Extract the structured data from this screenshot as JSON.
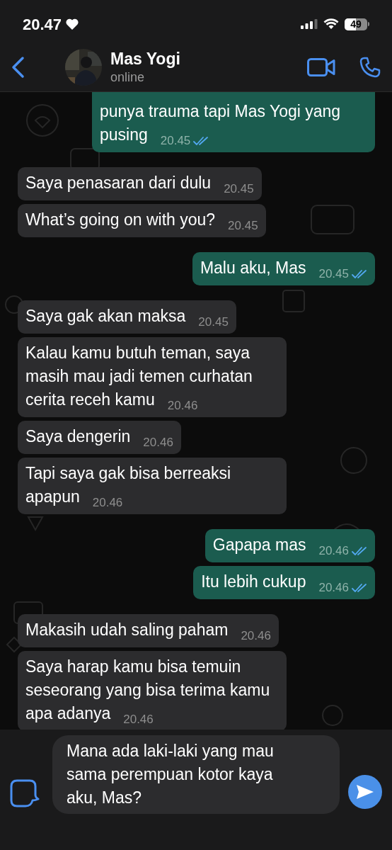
{
  "status_bar": {
    "time": "20.47",
    "battery": "49"
  },
  "header": {
    "name": "Mas Yogi",
    "status": "online"
  },
  "messages": [
    {
      "kind": "sent",
      "text": "punya trauma tapi Mas Yogi yang pusing",
      "time": "20.45",
      "read": true,
      "cut_top": true
    },
    {
      "kind": "received",
      "text": "Saya penasaran dari dulu",
      "time": "20.45"
    },
    {
      "kind": "received",
      "text": "What’s going on with you?",
      "time": "20.45"
    },
    {
      "kind": "sent",
      "text": "Malu aku, Mas",
      "time": "20.45",
      "read": true
    },
    {
      "kind": "received",
      "text": "Saya gak akan maksa",
      "time": "20.45"
    },
    {
      "kind": "received",
      "text": "Kalau kamu butuh teman, saya masih mau jadi temen curhatan cerita receh kamu",
      "time": "20.46"
    },
    {
      "kind": "received",
      "text": "Saya dengerin",
      "time": "20.46"
    },
    {
      "kind": "received",
      "text": "Tapi saya gak bisa berreaksi apapun",
      "time": "20.46"
    },
    {
      "kind": "sent",
      "text": "Gapapa mas",
      "time": "20.46",
      "read": true
    },
    {
      "kind": "sent",
      "text": "Itu lebih cukup",
      "time": "20.46",
      "read": true
    },
    {
      "kind": "received",
      "text": "Makasih udah saling paham",
      "time": "20.46"
    },
    {
      "kind": "received",
      "text": "Saya harap kamu bisa temuin seseorang yang bisa terima kamu apa adanya",
      "time": "20.46"
    }
  ],
  "composer": {
    "value": "Mana ada laki-laki yang mau sama perempuan kotor kaya aku, Mas?"
  }
}
